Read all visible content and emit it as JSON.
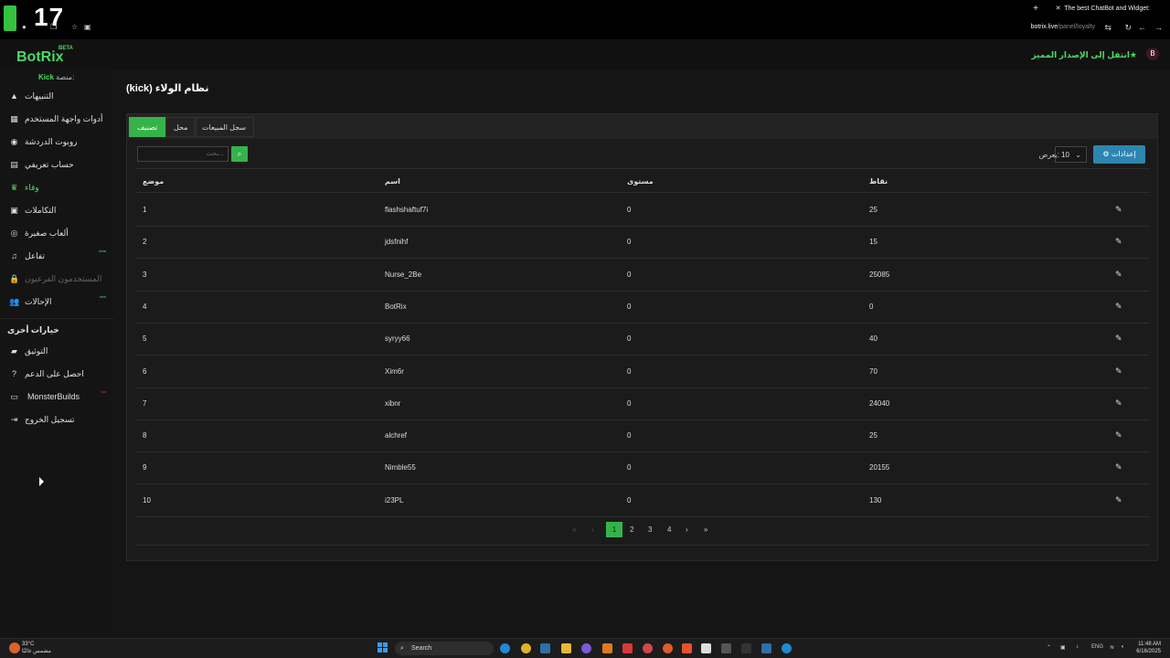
{
  "chrome": {
    "clock": "17",
    "tab_title": "The best ChatBot and Widget:",
    "url_domain": "botrix.live",
    "url_path": "/panel/loyalty"
  },
  "header": {
    "brand": "BotRix",
    "beta": "BETA",
    "premium_label": "انتقل إلى الإصدار المميز",
    "platform_label": "منصة:",
    "platform_value": "Kick"
  },
  "sidebar": {
    "items": [
      {
        "label": "التنبيهات",
        "icon": "warning-icon"
      },
      {
        "label": "أدوات واجهة المستخدم",
        "icon": "widgets-icon"
      },
      {
        "label": "روبوت الدردشة",
        "icon": "robot-icon"
      },
      {
        "label": "حساب تعريفي",
        "icon": "id-card-icon"
      },
      {
        "label": "وفاء",
        "icon": "trophy-icon"
      },
      {
        "label": "التكاملات",
        "icon": "integrations-icon"
      },
      {
        "label": "ألعاب صغيرة",
        "icon": "gamepad-icon"
      },
      {
        "label": "تفاعل",
        "icon": "music-icon",
        "badge": "beta"
      },
      {
        "label": "المستخدمون الفرعيون",
        "icon": "lock-icon"
      },
      {
        "label": "الإحالات",
        "icon": "users-icon",
        "badge": "new"
      }
    ],
    "section_title": "خيارات أخرى",
    "other_items": [
      {
        "label": "التوثيق",
        "icon": "book-icon"
      },
      {
        "label": "احصل على الدعم",
        "icon": "question-icon"
      },
      {
        "label": "MonsterBuilds",
        "icon": "laptop-icon",
        "badge": "hot"
      },
      {
        "label": "تسجيل الخروج",
        "icon": "logout-icon"
      }
    ]
  },
  "main": {
    "title": "نظام الولاء (kick)",
    "tabs": [
      "تصنيف",
      "محل",
      "سجل المبيعات"
    ],
    "search_placeholder": "...بحث",
    "show_label": "يعرض:",
    "page_size": "10",
    "settings_label": "إعدادات",
    "columns": [
      "موضع",
      "اسم",
      "مستوى",
      "نقاط"
    ],
    "rows": [
      [
        "1",
        "flashshaftuf7i",
        "0",
        "25"
      ],
      [
        "2",
        "jdsfnihf",
        "0",
        "15"
      ],
      [
        "3",
        "Nurse_2Be",
        "0",
        "25085"
      ],
      [
        "4",
        "BotRix",
        "0",
        "0"
      ],
      [
        "5",
        "syryy66",
        "0",
        "40"
      ],
      [
        "6",
        "Xim6r",
        "0",
        "70"
      ],
      [
        "7",
        "xibnr",
        "0",
        "24040"
      ],
      [
        "8",
        "alchref",
        "0",
        "25"
      ],
      [
        "9",
        "Nimble55",
        "0",
        "20155"
      ],
      [
        "10",
        "i23PL",
        "0",
        "130"
      ]
    ],
    "pagination": [
      "1",
      "2",
      "3",
      "4"
    ],
    "current_page": "1"
  },
  "taskbar": {
    "temperature": "33°C",
    "weather_text": "مشمس غالبًا",
    "search_label": "Search",
    "lang": "ENG",
    "time": "11:48 AM",
    "date": "6/16/2025"
  },
  "colors": {
    "accent": "#35b34a",
    "brand": "#4cd964",
    "settings": "#2c86b0"
  }
}
